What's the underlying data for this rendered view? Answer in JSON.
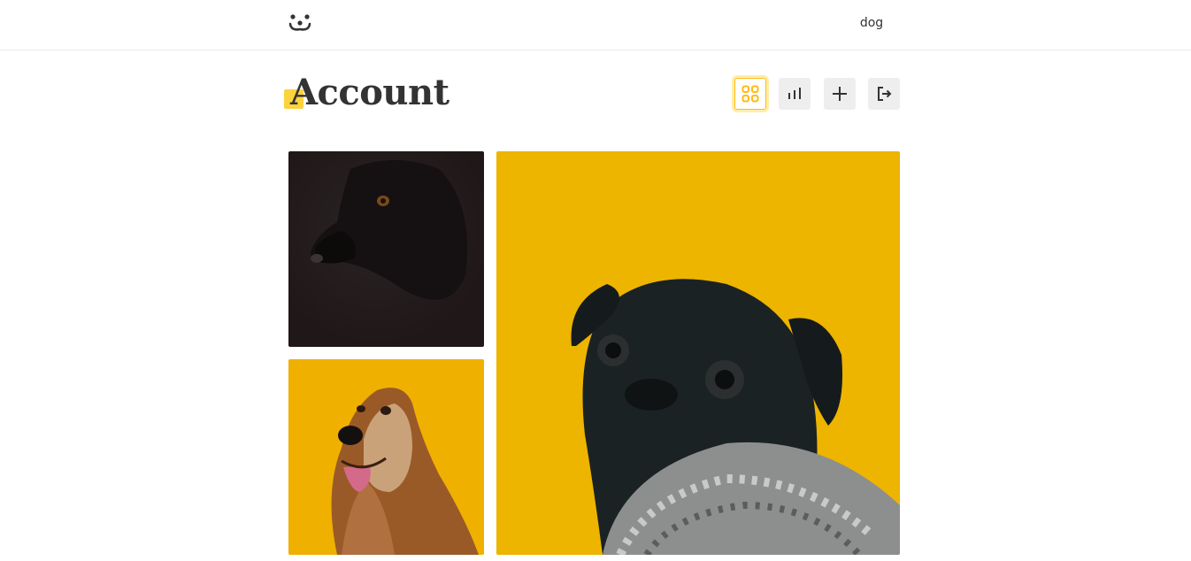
{
  "header": {
    "username": "dog",
    "logo_icon": "dog-face-icon"
  },
  "main": {
    "title": "Account",
    "accent_color": "#fbd33c",
    "nav_buttons": [
      {
        "icon": "grid-icon",
        "active": true
      },
      {
        "icon": "bar-chart-icon",
        "active": false
      },
      {
        "icon": "plus-icon",
        "active": false
      },
      {
        "icon": "logout-icon",
        "active": false
      }
    ]
  },
  "photos": [
    {
      "subject": "black-dog-photo"
    },
    {
      "subject": "afghan-hound-photo"
    },
    {
      "subject": "black-pug-photo"
    }
  ]
}
